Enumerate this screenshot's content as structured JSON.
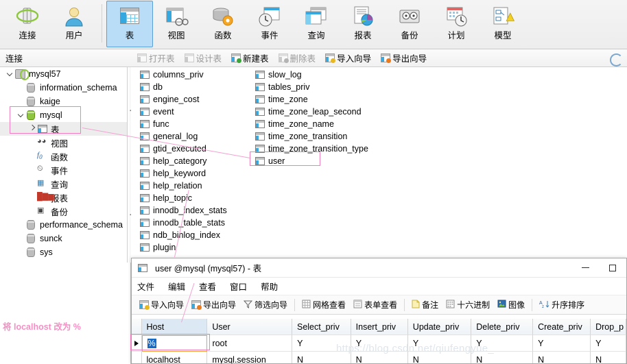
{
  "ribbon": {
    "buttons": [
      {
        "label": "连接",
        "icon": "connection-icon"
      },
      {
        "label": "用户",
        "icon": "user-icon"
      },
      {
        "label": "表",
        "icon": "table-icon",
        "selected": true
      },
      {
        "label": "视图",
        "icon": "view-icon"
      },
      {
        "label": "函数",
        "icon": "function-icon"
      },
      {
        "label": "事件",
        "icon": "event-icon"
      },
      {
        "label": "查询",
        "icon": "query-icon"
      },
      {
        "label": "报表",
        "icon": "report-icon"
      },
      {
        "label": "备份",
        "icon": "backup-icon"
      },
      {
        "label": "计划",
        "icon": "schedule-icon"
      },
      {
        "label": "模型",
        "icon": "model-icon"
      }
    ]
  },
  "connection_bar": {
    "label": "连接",
    "buttons": [
      {
        "label": "打开表",
        "enabled": false
      },
      {
        "label": "设计表",
        "enabled": false
      },
      {
        "label": "新建表",
        "enabled": true
      },
      {
        "label": "删除表",
        "enabled": false
      },
      {
        "label": "导入向导",
        "enabled": true
      },
      {
        "label": "导出向导",
        "enabled": true
      }
    ],
    "refresh_icon": "refresh-icon"
  },
  "sidebar": {
    "items": [
      {
        "label": "mysql57",
        "depth": 0,
        "icon": "server-icon",
        "twisty": "down"
      },
      {
        "label": "information_schema",
        "depth": 1,
        "icon": "database-icon",
        "twisty": "none"
      },
      {
        "label": "kaige",
        "depth": 1,
        "icon": "database-icon",
        "twisty": "none"
      },
      {
        "label": "mysql",
        "depth": 1,
        "icon": "database-open-icon",
        "twisty": "down",
        "highlight": true
      },
      {
        "label": "表",
        "depth": 2,
        "icon": "table-icon",
        "twisty": "right",
        "selected": true
      },
      {
        "label": "视图",
        "depth": 2,
        "icon": "view-icon",
        "twisty": "none"
      },
      {
        "label": "函数",
        "depth": 2,
        "icon": "function-icon",
        "twisty": "none"
      },
      {
        "label": "事件",
        "depth": 2,
        "icon": "event-icon",
        "twisty": "none"
      },
      {
        "label": "查询",
        "depth": 2,
        "icon": "query-icon",
        "twisty": "none"
      },
      {
        "label": "报表",
        "depth": 2,
        "icon": "report-icon",
        "twisty": "none"
      },
      {
        "label": "备份",
        "depth": 2,
        "icon": "backup-icon",
        "twisty": "none"
      },
      {
        "label": "performance_schema",
        "depth": 1,
        "icon": "database-icon",
        "twisty": "none"
      },
      {
        "label": "sunck",
        "depth": 1,
        "icon": "database-icon",
        "twisty": "none"
      },
      {
        "label": "sys",
        "depth": 1,
        "icon": "database-icon",
        "twisty": "none"
      }
    ]
  },
  "table_list": {
    "column1": [
      "columns_priv",
      "db",
      "engine_cost",
      "event",
      "func",
      "general_log",
      "gtid_executed",
      "help_category",
      "help_keyword",
      "help_relation",
      "help_topic",
      "innodb_index_stats",
      "innodb_table_stats",
      "ndb_binlog_index",
      "plugin"
    ],
    "column2": [
      "slow_log",
      "tables_priv",
      "time_zone",
      "time_zone_leap_second",
      "time_zone_name",
      "time_zone_transition",
      "time_zone_transition_type",
      "user"
    ],
    "highlighted_item": "user"
  },
  "child_window": {
    "title": "user @mysql (mysql57) - 表",
    "title_icon": "table-icon",
    "minimize_label": "–",
    "maximize_label": "□",
    "menu": [
      "文件",
      "编辑",
      "查看",
      "窗口",
      "帮助"
    ],
    "toolbar": [
      {
        "label": "导入向导",
        "icon": "import-wizard-icon"
      },
      {
        "label": "导出向导",
        "icon": "export-wizard-icon"
      },
      {
        "label": "筛选向导",
        "icon": "filter-icon"
      },
      {
        "label": "网格查看",
        "icon": "grid-view-icon"
      },
      {
        "label": "表单查看",
        "icon": "form-view-icon"
      },
      {
        "label": "备注",
        "icon": "memo-icon"
      },
      {
        "label": "十六进制",
        "icon": "hex-icon"
      },
      {
        "label": "图像",
        "icon": "image-icon"
      },
      {
        "label": "升序排序",
        "icon": "sort-asc-icon"
      }
    ]
  },
  "grid": {
    "columns": [
      "Host",
      "User",
      "Select_priv",
      "Insert_priv",
      "Update_priv",
      "Delete_priv",
      "Create_priv",
      "Drop_p"
    ],
    "rows": [
      {
        "current": true,
        "editing": true,
        "cells": [
          "%",
          "root",
          "Y",
          "Y",
          "Y",
          "Y",
          "Y",
          "Y"
        ]
      },
      {
        "current": false,
        "editing": false,
        "cells": [
          "localhost",
          "mysql.session",
          "N",
          "N",
          "N",
          "N",
          "N",
          "N"
        ]
      }
    ]
  },
  "annotation": {
    "note": "将 localhost 改为 %",
    "watermark": "https://blog.csdn.net/qiufengyue_"
  },
  "colors": {
    "accent_pink": "#f07fc0",
    "selection_blue": "#1569c7",
    "ribbon_selected": "#b9dcf7"
  }
}
